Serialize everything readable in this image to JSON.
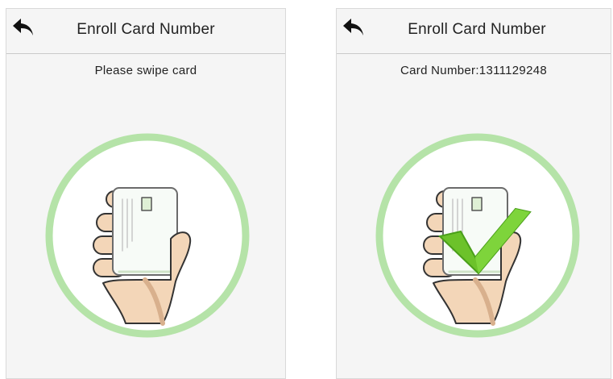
{
  "screens": [
    {
      "title": "Enroll Card Number",
      "prompt": "Please swipe card",
      "back_icon": "back-arrow-icon",
      "illustration": "hand-holding-card-icon",
      "success_check": false
    },
    {
      "title": "Enroll Card Number",
      "prompt": "Card Number:1311129248",
      "back_icon": "back-arrow-icon",
      "illustration": "hand-holding-card-icon",
      "success_check": true
    }
  ],
  "colors": {
    "ring": "#a8e09a",
    "ring_inner": "#ffffff",
    "hand": "#f3d6b8",
    "hand_stroke": "#3a3a3a",
    "check": "#6cc22a"
  }
}
